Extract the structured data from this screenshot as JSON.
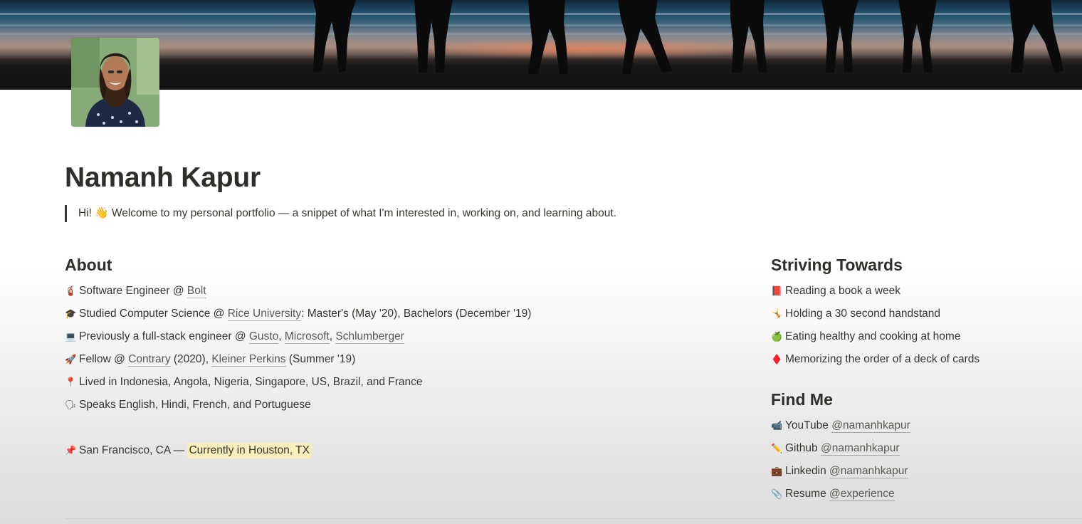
{
  "header": {
    "title": "Namanh Kapur",
    "intro": "Hi! 👋 Welcome to my personal portfolio — a snippet of what I'm interested in, working on, and learning about."
  },
  "about": {
    "heading": "About",
    "items": [
      {
        "icon": "🧯",
        "icon_name": "fire-extinguisher-icon",
        "parts": [
          {
            "text": "Software Engineer @ "
          },
          {
            "text": "Bolt",
            "link": true
          }
        ]
      },
      {
        "icon": "🎓",
        "icon_name": "graduation-cap-icon",
        "parts": [
          {
            "text": "Studied Computer Science @ "
          },
          {
            "text": "Rice University",
            "link": true
          },
          {
            "text": ": Master's (May '20), Bachelors (December '19)"
          }
        ]
      },
      {
        "icon": "💻",
        "icon_name": "laptop-icon",
        "parts": [
          {
            "text": "Previously a full-stack engineer @ "
          },
          {
            "text": "Gusto",
            "link": true
          },
          {
            "text": ", "
          },
          {
            "text": "Microsoft",
            "link": true
          },
          {
            "text": ", "
          },
          {
            "text": "Schlumberger",
            "link": true
          }
        ]
      },
      {
        "icon": "🚀",
        "icon_name": "rocket-icon",
        "parts": [
          {
            "text": "Fellow @ "
          },
          {
            "text": "Contrary",
            "link": true
          },
          {
            "text": " (2020), "
          },
          {
            "text": "Kleiner Perkins",
            "link": true
          },
          {
            "text": " (Summer '19)"
          }
        ]
      },
      {
        "icon": "📍",
        "icon_name": "map-pin-icon",
        "parts": [
          {
            "text": "Lived in Indonesia, Angola, Nigeria, Singapore, US, Brazil, and France"
          }
        ]
      },
      {
        "icon": "🗣",
        "icon_name": "speaking-head-icon",
        "parts": [
          {
            "text": "Speaks English, Hindi, French, and Portuguese"
          }
        ]
      },
      {
        "spacer": true
      },
      {
        "icon": "📌",
        "icon_name": "pushpin-icon",
        "parts": [
          {
            "text": "San Francisco, CA — "
          },
          {
            "text": "Currently in Houston, TX",
            "highlight": true
          }
        ]
      }
    ]
  },
  "striving": {
    "heading": "Striving Towards",
    "items": [
      {
        "icon": "📕",
        "icon_name": "book-icon",
        "parts": [
          {
            "text": "Reading a book a week"
          }
        ]
      },
      {
        "icon": "🤸",
        "icon_name": "handstand-icon",
        "parts": [
          {
            "text": "Holding a 30 second handstand"
          }
        ]
      },
      {
        "icon": "🍏",
        "icon_name": "apple-icon",
        "parts": [
          {
            "text": "Eating healthy and cooking at home"
          }
        ]
      },
      {
        "icon": "♦️",
        "icon_name": "diamond-suit-icon",
        "parts": [
          {
            "text": "Memorizing the order of a deck of cards"
          }
        ]
      }
    ]
  },
  "find_me": {
    "heading": "Find Me",
    "items": [
      {
        "icon": "📹",
        "icon_name": "video-camera-icon",
        "parts": [
          {
            "text": "YouTube "
          },
          {
            "text": "@namanhkapur",
            "link": true
          }
        ]
      },
      {
        "icon": "✏️",
        "icon_name": "pencil-icon",
        "parts": [
          {
            "text": "Github "
          },
          {
            "text": "@namanhkapur",
            "link": true
          }
        ]
      },
      {
        "icon": "💼",
        "icon_name": "briefcase-icon",
        "parts": [
          {
            "text": "Linkedin "
          },
          {
            "text": "@namanhkapur",
            "link": true
          }
        ]
      },
      {
        "icon": "📎",
        "icon_name": "paperclip-icon",
        "parts": [
          {
            "text": "Resume "
          },
          {
            "text": "@experience",
            "link": true
          }
        ]
      }
    ]
  },
  "colors": {
    "text": "#37352f",
    "highlight": "#f8eebb",
    "link_underline": "#a3a29e"
  }
}
